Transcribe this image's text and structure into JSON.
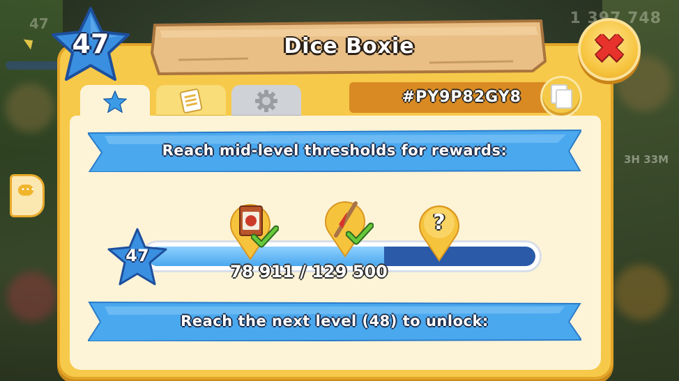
{
  "background": {
    "level_text": "47",
    "coins_text": "1 397 748",
    "timer_text": "3H 33M"
  },
  "header": {
    "level": "47",
    "title": "Dice Boxie",
    "close_icon": "close-x-icon"
  },
  "tabs": [
    {
      "name": "profile",
      "icon": "star-icon",
      "active": true
    },
    {
      "name": "achievements",
      "icon": "document-icon",
      "active": false
    },
    {
      "name": "settings",
      "icon": "gear-icon",
      "active": false
    }
  ],
  "player": {
    "id": "#PY9P82GY8",
    "copy_icon": "copy-icon"
  },
  "rewards": {
    "banner_text": "Reach mid-level thresholds for rewards:",
    "current_level": "47",
    "progress_text": "78 911 / 129 500",
    "progress_fraction": 0.609,
    "markers": [
      {
        "icon": "seed-packet-icon",
        "claimed": true
      },
      {
        "icon": "ribbon-pole-icon",
        "claimed": true
      },
      {
        "icon": "question-mark-icon",
        "claimed": false,
        "label": "?"
      }
    ],
    "footer_text": "Reach the next level (48) to unlock:"
  },
  "colors": {
    "panel": "#f7c94a",
    "ribbon": "#4aa8ee",
    "bar_fill": "#4aa8ee",
    "bar_track": "#2a5aa8",
    "close": "#e8322c"
  }
}
